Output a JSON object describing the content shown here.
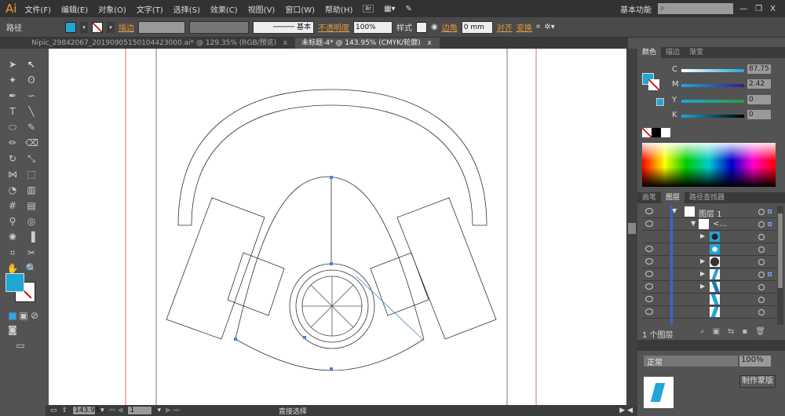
{
  "app": {
    "logo": "Ai"
  },
  "menu": [
    "文件(F)",
    "编辑(E)",
    "对象(O)",
    "文字(T)",
    "选择(S)",
    "效果(C)",
    "视图(V)",
    "窗口(W)",
    "帮助(H)"
  ],
  "workspace": "基本功能",
  "window_controls": [
    "—",
    "❐",
    "X"
  ],
  "control": {
    "object_type": "路径",
    "stroke_label": "描边",
    "stroke_style": "基本",
    "opacity_label": "不透明度",
    "opacity": "100%",
    "style_label": "样式",
    "corner_label": "边角",
    "corner_value": "0 mm",
    "align": "对齐",
    "transform": "变换"
  },
  "tabs": [
    {
      "label": "Nipic_29842067_20190905150104423000.ai* @ 129.35% (RGB/预览)",
      "close": "x"
    },
    {
      "label": "未标题-4* @ 143.95% (CMYK/轮廓)",
      "close": "x",
      "active": true
    }
  ],
  "colors": {
    "fill": "#1fa6d4",
    "accent_orange": "#e49a3a",
    "layer_blue": "#3d63d8"
  },
  "color_panel": {
    "tabs": [
      "颜色",
      "描边",
      "渐变"
    ],
    "channels": [
      {
        "label": "C",
        "value": "87.75",
        "pct": 87.75
      },
      {
        "label": "M",
        "value": "2.42",
        "pct": 2.42
      },
      {
        "label": "Y",
        "value": "0",
        "pct": 0
      },
      {
        "label": "K",
        "value": "0",
        "pct": 0
      }
    ],
    "unit": "%"
  },
  "layers_panel": {
    "tabs": [
      "画笔",
      "图层",
      "路径查找器"
    ],
    "layer_name": "图层 1",
    "group_name": "<...",
    "footer": "1 个图层"
  },
  "transparency": {
    "mode": "正常",
    "opacity": "100%",
    "mask_button": "制作蒙版"
  },
  "status": {
    "zoom": "143.95",
    "page": "1",
    "tool": "直接选择"
  }
}
